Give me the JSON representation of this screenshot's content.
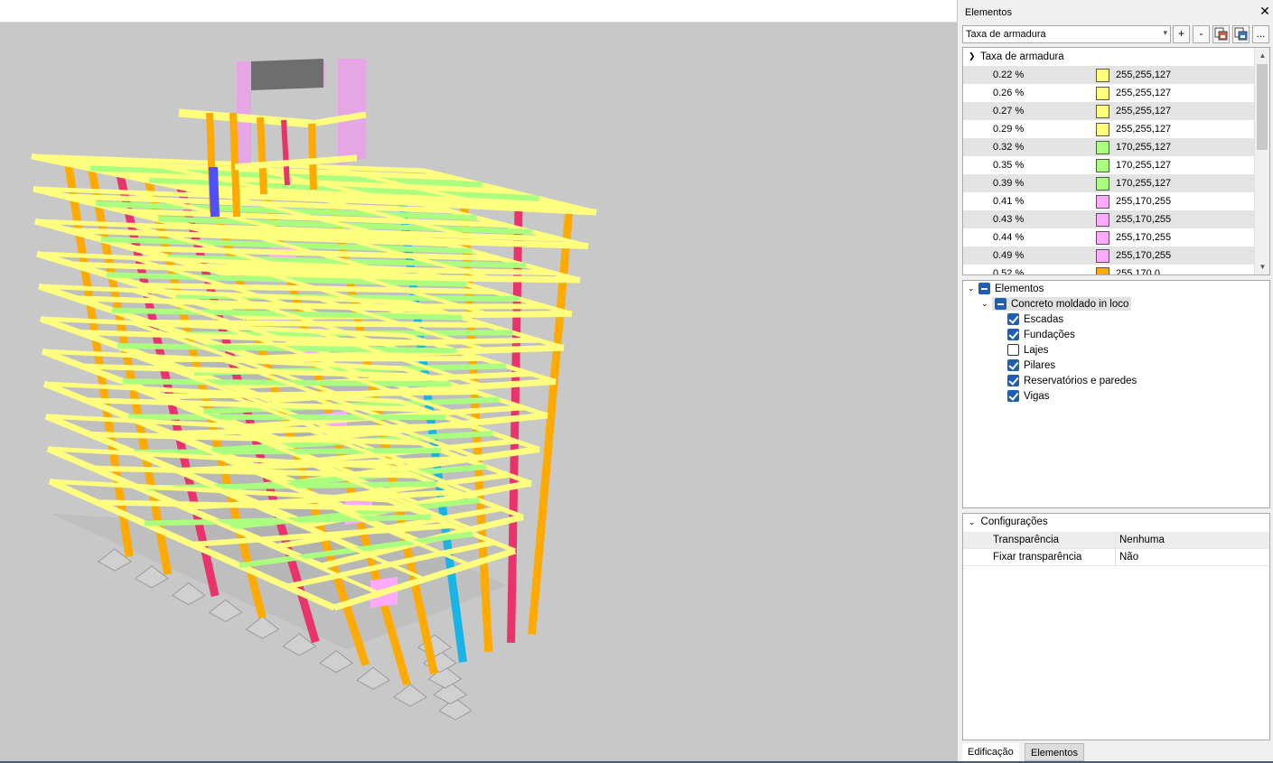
{
  "panel": {
    "title": "Elementos",
    "close": "✕",
    "mode_select": {
      "value": "Taxa de armadura",
      "arrow": "▾"
    },
    "toolbar": {
      "add": "+",
      "remove": "-",
      "more": "..."
    }
  },
  "legend": {
    "title": "Taxa de armadura",
    "rows": [
      {
        "pct": "0.22 %",
        "rgb": "255,255,127",
        "color": "#ffff7f"
      },
      {
        "pct": "0.26 %",
        "rgb": "255,255,127",
        "color": "#ffff7f"
      },
      {
        "pct": "0.27 %",
        "rgb": "255,255,127",
        "color": "#ffff7f"
      },
      {
        "pct": "0.29 %",
        "rgb": "255,255,127",
        "color": "#ffff7f"
      },
      {
        "pct": "0.32 %",
        "rgb": "170,255,127",
        "color": "#aaff7f"
      },
      {
        "pct": "0.35 %",
        "rgb": "170,255,127",
        "color": "#aaff7f"
      },
      {
        "pct": "0.39 %",
        "rgb": "170,255,127",
        "color": "#aaff7f"
      },
      {
        "pct": "0.41 %",
        "rgb": "255,170,255",
        "color": "#ffaaff"
      },
      {
        "pct": "0.43 %",
        "rgb": "255,170,255",
        "color": "#ffaaff"
      },
      {
        "pct": "0.44 %",
        "rgb": "255,170,255",
        "color": "#ffaaff"
      },
      {
        "pct": "0.49 %",
        "rgb": "255,170,255",
        "color": "#ffaaff"
      },
      {
        "pct": "0.52 %",
        "rgb": "255,170,0",
        "color": "#ffaa00"
      }
    ]
  },
  "tree": {
    "root": "Elementos",
    "group": "Concreto moldado in loco",
    "items": [
      {
        "label": "Escadas",
        "checked": true
      },
      {
        "label": "Fundações",
        "checked": true
      },
      {
        "label": "Lajes",
        "checked": false
      },
      {
        "label": "Pilares",
        "checked": true
      },
      {
        "label": "Reservatórios e paredes",
        "checked": true
      },
      {
        "label": "Vigas",
        "checked": true
      }
    ]
  },
  "config": {
    "title": "Configurações",
    "rows": [
      {
        "key": "Transparência",
        "value": "Nenhuma"
      },
      {
        "key": "Fixar transparência",
        "value": "Não"
      }
    ]
  },
  "tabs": {
    "edificacao": "Edificação",
    "elementos": "Elementos"
  },
  "model_colors": {
    "beam_yellow": "#ffff7f",
    "beam_green": "#aaff7f",
    "column_orange": "#ffaa00",
    "column_pink": "#ffaaff",
    "column_red": "#e8336b",
    "column_cyan": "#19b4e6",
    "column_blue": "#5050ff",
    "foundation": "#d0d0d0",
    "background": "#c8c8c8"
  }
}
